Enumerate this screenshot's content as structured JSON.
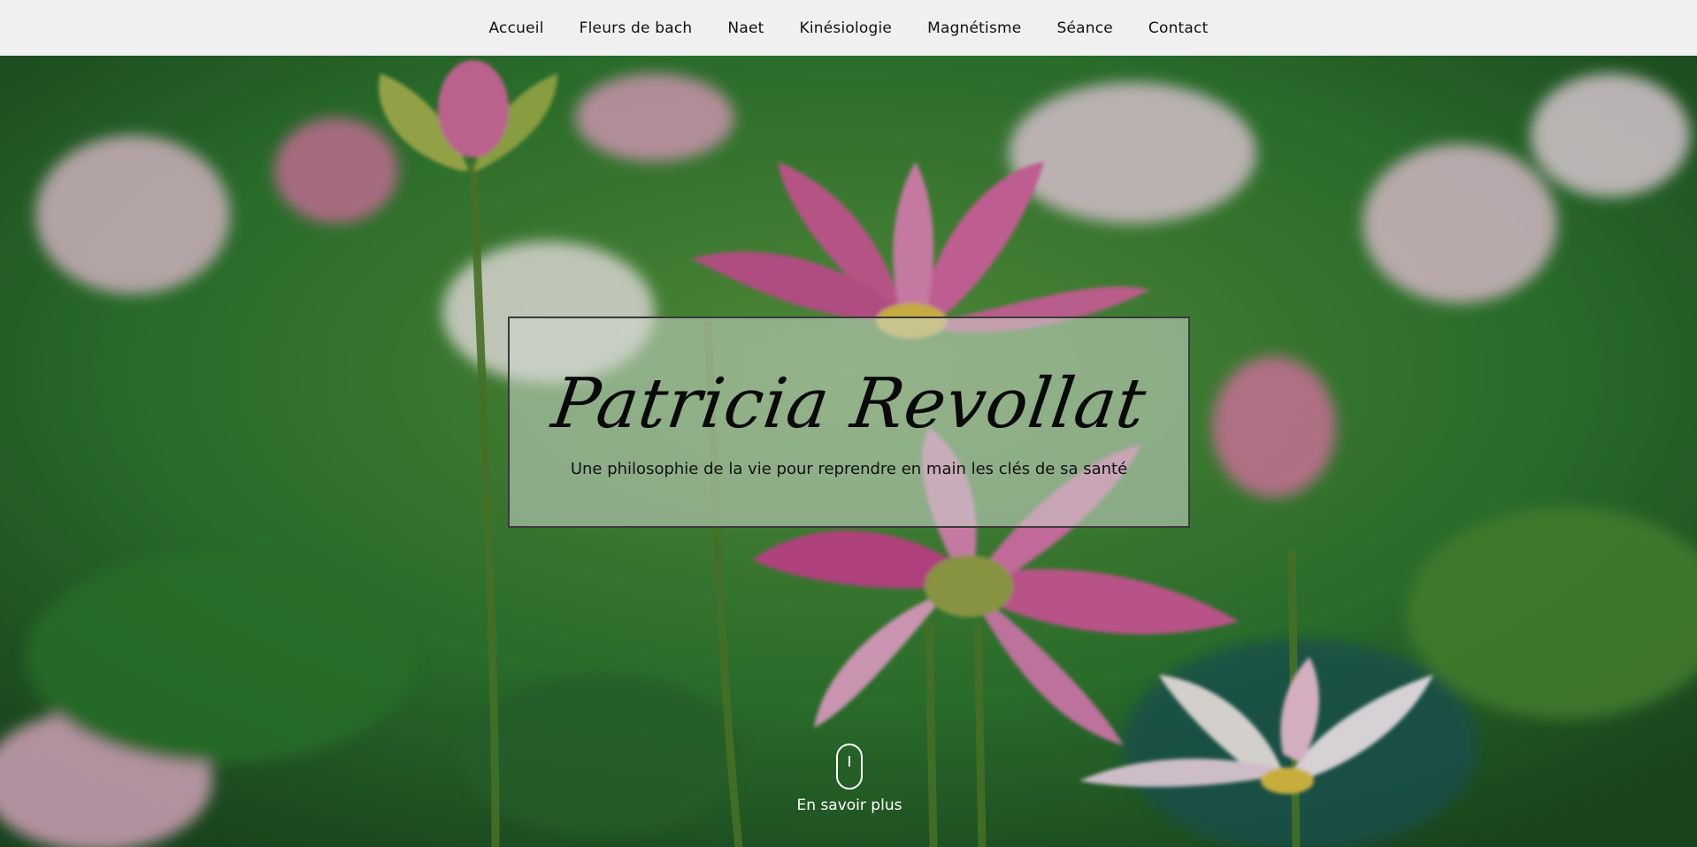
{
  "nav": {
    "items": [
      {
        "label": "Accueil"
      },
      {
        "label": "Fleurs de bach"
      },
      {
        "label": "Naet"
      },
      {
        "label": "Kinésiologie"
      },
      {
        "label": "Magnétisme"
      },
      {
        "label": "Séance"
      },
      {
        "label": "Contact"
      }
    ]
  },
  "hero": {
    "title": "Patricia Revollat",
    "subtitle": "Une philosophie de la vie pour reprendre en main les clés de sa santé",
    "scroll_label": "En savoir plus",
    "image_subject": "lotus flowers"
  },
  "colors": {
    "nav_bg": "#f0f0f0",
    "title_box_bg": "rgba(205,215,205,0.55)",
    "text": "#111111",
    "scroll_text": "#ffffff"
  }
}
